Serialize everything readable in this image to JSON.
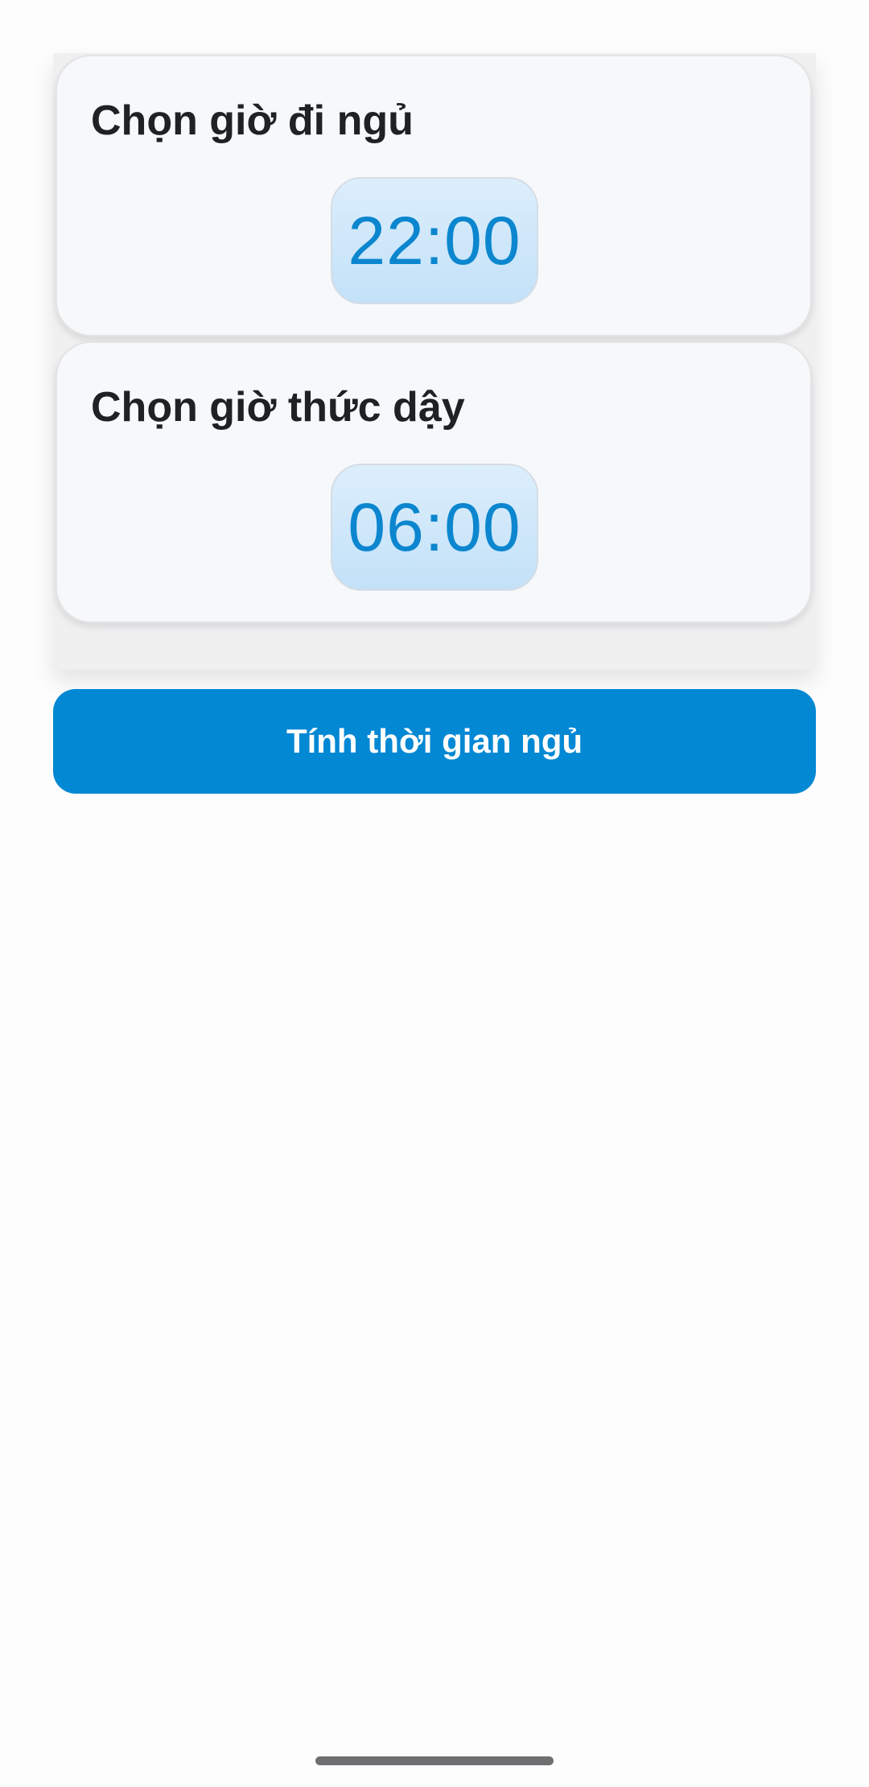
{
  "bedtime_card": {
    "title": "Chọn giờ đi ngủ",
    "time": "22:00"
  },
  "wakeup_card": {
    "title": "Chọn giờ thức dậy",
    "time": "06:00"
  },
  "actions": {
    "calculate_label": "Tính thời gian ngủ"
  },
  "colors": {
    "accent": "#0388d4",
    "time_text": "#0b86cf",
    "time_bg": "#c9e4f9",
    "card_bg": "#f7f8fa",
    "title_text": "#202124"
  }
}
